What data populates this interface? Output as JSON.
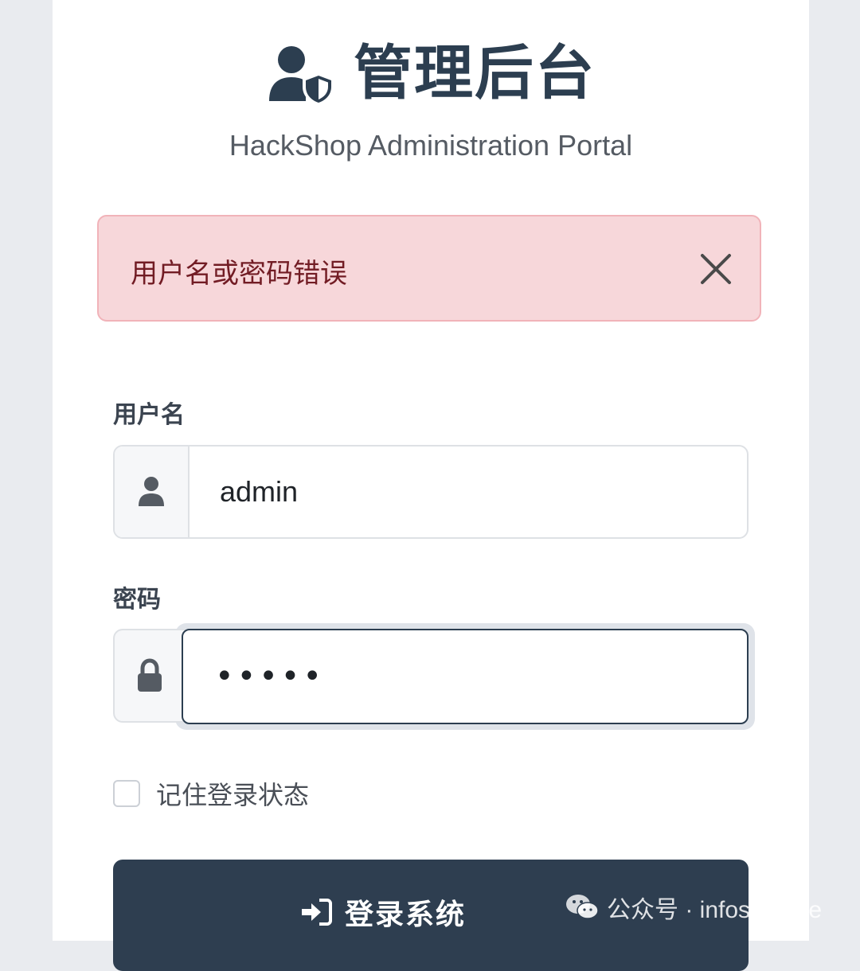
{
  "brand": {
    "title": "管理后台",
    "subtitle": "HackShop Administration Portal",
    "icon": "user-shield-icon"
  },
  "alert": {
    "message": "用户名或密码错误",
    "close_icon": "close-icon",
    "background": "#f7d7da",
    "text_color": "#721c24"
  },
  "form": {
    "username": {
      "label": "用户名",
      "value": "admin",
      "icon": "user-icon"
    },
    "password": {
      "label": "密码",
      "masked_value": "•••••",
      "icon": "lock-icon"
    },
    "remember": {
      "label": "记住登录状态",
      "checked": false
    },
    "submit": {
      "label": "登录系统",
      "icon": "sign-in-icon",
      "background": "#2e3e50"
    }
  },
  "watermark": {
    "text": "公众号 · infosecnote",
    "icon": "wechat-icon"
  }
}
